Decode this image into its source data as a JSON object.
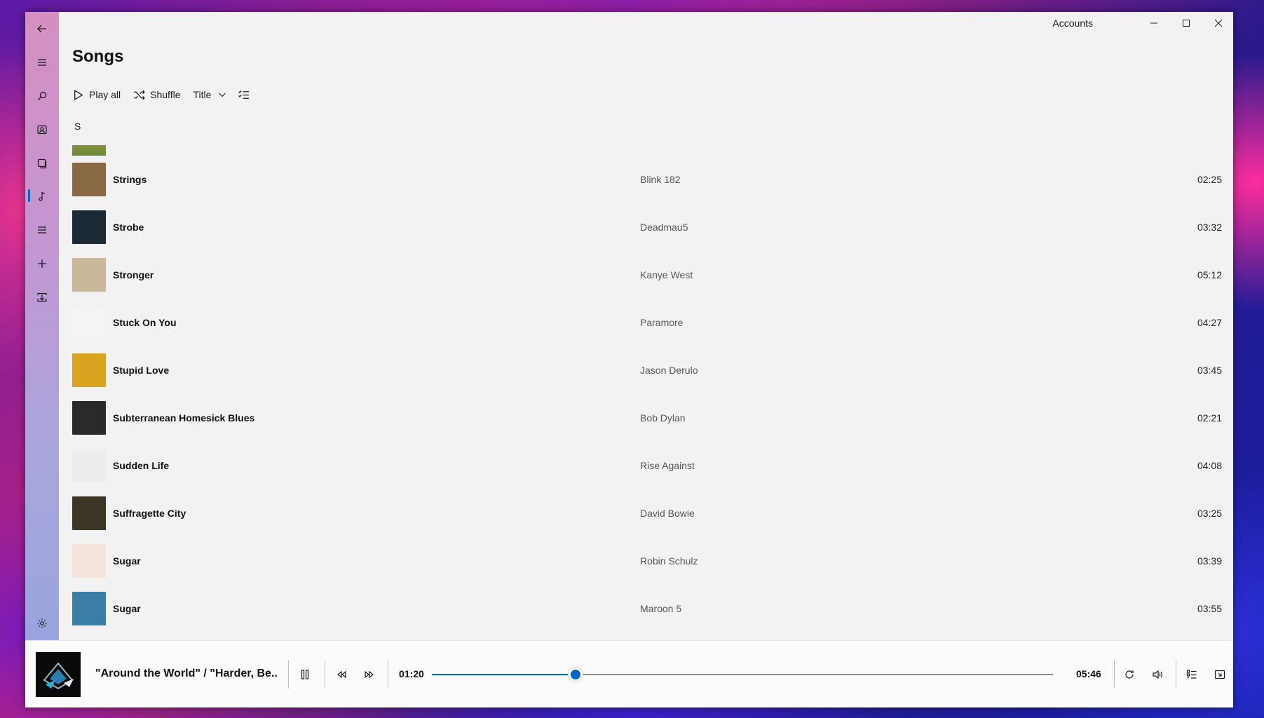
{
  "window": {
    "title": "Accounts"
  },
  "sidebar": {
    "items": [
      {
        "name": "back-icon"
      },
      {
        "name": "menu-icon"
      },
      {
        "name": "search-icon"
      },
      {
        "name": "artists-icon"
      },
      {
        "name": "albums-icon"
      },
      {
        "name": "music-note-icon"
      },
      {
        "name": "playlists-icon"
      },
      {
        "name": "add-icon"
      },
      {
        "name": "download-icon"
      },
      {
        "name": "gear-icon"
      }
    ],
    "active": "music-note-icon"
  },
  "page": {
    "title": "Songs"
  },
  "toolbar": {
    "play_all": "Play all",
    "shuffle": "Shuffle",
    "sort_value": "Title"
  },
  "group": {
    "letter": "S"
  },
  "songs": [
    {
      "title": "Strings",
      "artist": "Blink 182",
      "duration": "02:25",
      "art_color": "#8a6a44"
    },
    {
      "title": "Strobe",
      "artist": "Deadmau5",
      "duration": "03:32",
      "art_color": "#1b2a35"
    },
    {
      "title": "Stronger",
      "artist": "Kanye West",
      "duration": "05:12",
      "art_color": "#c9b89a"
    },
    {
      "title": "Stuck On You",
      "artist": "Paramore",
      "duration": "04:27",
      "art_color": "#f4f4f6"
    },
    {
      "title": "Stupid Love",
      "artist": "Jason Derulo",
      "duration": "03:45",
      "art_color": "#d9a520"
    },
    {
      "title": "Subterranean Homesick Blues",
      "artist": "Bob Dylan",
      "duration": "02:21",
      "art_color": "#2a2a2a"
    },
    {
      "title": "Sudden Life",
      "artist": "Rise Against",
      "duration": "04:08",
      "art_color": "#ededed"
    },
    {
      "title": "Suffragette City",
      "artist": "David Bowie",
      "duration": "03:25",
      "art_color": "#3b3626"
    },
    {
      "title": "Sugar",
      "artist": "Robin Schulz",
      "duration": "03:39",
      "art_color": "#f3e4dc"
    },
    {
      "title": "Sugar",
      "artist": "Maroon 5",
      "duration": "03:55",
      "art_color": "#3a7ea8"
    }
  ],
  "player": {
    "now_playing": "\"Around the World\" / \"Harder, Be...",
    "elapsed": "01:20",
    "total": "05:46",
    "progress": 0.2312,
    "accent": "#0067c0"
  }
}
